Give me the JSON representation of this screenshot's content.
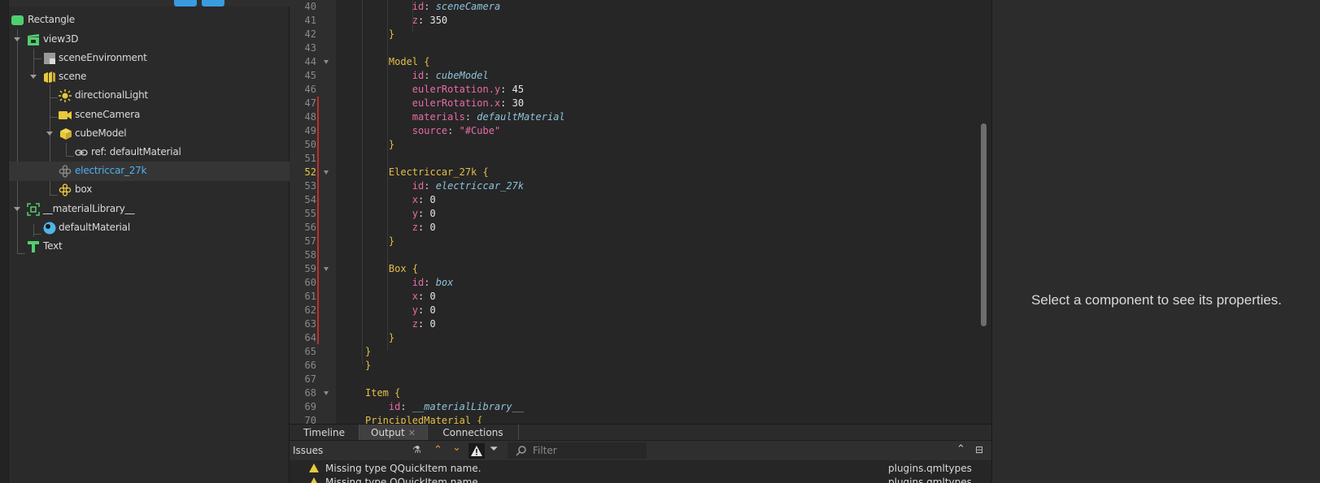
{
  "navigator": {
    "items": [
      {
        "label": "Rectangle",
        "icon": "rectangle-icon"
      },
      {
        "label": "view3D",
        "icon": "view3d-icon"
      },
      {
        "label": "sceneEnvironment",
        "icon": "scene-environment-icon"
      },
      {
        "label": "scene",
        "icon": "scene-node-icon"
      },
      {
        "label": "directionalLight",
        "icon": "light-icon"
      },
      {
        "label": "sceneCamera",
        "icon": "camera-icon"
      },
      {
        "label": "cubeModel",
        "icon": "model-icon"
      },
      {
        "label": "ref: defaultMaterial",
        "icon": "link-icon"
      },
      {
        "label": "electriccar_27k",
        "icon": "component-icon"
      },
      {
        "label": "box",
        "icon": "component-icon"
      },
      {
        "label": "__materialLibrary__",
        "icon": "item-icon"
      },
      {
        "label": "defaultMaterial",
        "icon": "material-icon"
      },
      {
        "label": "Text",
        "icon": "text-icon"
      }
    ],
    "selected": "electriccar_27k"
  },
  "editor": {
    "current_line": "52",
    "lines": [
      {
        "n": "40",
        "t": [
          [
            "        ",
            "p"
          ],
          [
            "id",
            "prop"
          ],
          [
            ": ",
            "p"
          ],
          [
            "sceneCamera",
            "id"
          ]
        ]
      },
      {
        "n": "41",
        "t": [
          [
            "        ",
            "p"
          ],
          [
            "z",
            "prop"
          ],
          [
            ": 350",
            "num"
          ]
        ]
      },
      {
        "n": "42",
        "t": [
          [
            "    }",
            "brace"
          ]
        ]
      },
      {
        "n": "43",
        "t": []
      },
      {
        "n": "44",
        "t": [
          [
            "    ",
            "p"
          ],
          [
            "Model",
            "type"
          ],
          [
            " {",
            "brace"
          ]
        ],
        "fold": true
      },
      {
        "n": "45",
        "t": [
          [
            "        ",
            "p"
          ],
          [
            "id",
            "prop"
          ],
          [
            ": ",
            "p"
          ],
          [
            "cubeModel",
            "id"
          ]
        ]
      },
      {
        "n": "46",
        "t": [
          [
            "        ",
            "p"
          ],
          [
            "eulerRotation.y",
            "prop"
          ],
          [
            ": 45",
            "num"
          ]
        ]
      },
      {
        "n": "47",
        "t": [
          [
            "        ",
            "p"
          ],
          [
            "eulerRotation.x",
            "prop"
          ],
          [
            ": 30",
            "num"
          ]
        ]
      },
      {
        "n": "48",
        "t": [
          [
            "        ",
            "p"
          ],
          [
            "materials",
            "prop"
          ],
          [
            ": ",
            "p"
          ],
          [
            "defaultMaterial",
            "id"
          ]
        ]
      },
      {
        "n": "49",
        "t": [
          [
            "        ",
            "p"
          ],
          [
            "source",
            "prop"
          ],
          [
            ": ",
            "p"
          ],
          [
            "\"#Cube\"",
            "str"
          ]
        ]
      },
      {
        "n": "50",
        "t": [
          [
            "    }",
            "brace"
          ]
        ]
      },
      {
        "n": "51",
        "t": []
      },
      {
        "n": "52",
        "t": [
          [
            "    ",
            "p"
          ],
          [
            "Electriccar_27k",
            "type"
          ],
          [
            " {",
            "brace"
          ]
        ],
        "fold": true
      },
      {
        "n": "53",
        "t": [
          [
            "        ",
            "p"
          ],
          [
            "id",
            "prop"
          ],
          [
            ": ",
            "p"
          ],
          [
            "electriccar_27k",
            "id"
          ]
        ]
      },
      {
        "n": "54",
        "t": [
          [
            "        ",
            "p"
          ],
          [
            "x",
            "prop"
          ],
          [
            ": 0",
            "num"
          ]
        ]
      },
      {
        "n": "55",
        "t": [
          [
            "        ",
            "p"
          ],
          [
            "y",
            "prop"
          ],
          [
            ": 0",
            "num"
          ]
        ]
      },
      {
        "n": "56",
        "t": [
          [
            "        ",
            "p"
          ],
          [
            "z",
            "prop"
          ],
          [
            ": 0",
            "num"
          ]
        ]
      },
      {
        "n": "57",
        "t": [
          [
            "    }",
            "brace"
          ]
        ]
      },
      {
        "n": "58",
        "t": []
      },
      {
        "n": "59",
        "t": [
          [
            "    ",
            "p"
          ],
          [
            "Box",
            "type"
          ],
          [
            " {",
            "brace"
          ]
        ],
        "fold": true
      },
      {
        "n": "60",
        "t": [
          [
            "        ",
            "p"
          ],
          [
            "id",
            "prop"
          ],
          [
            ": ",
            "p"
          ],
          [
            "box",
            "id"
          ]
        ]
      },
      {
        "n": "61",
        "t": [
          [
            "        ",
            "p"
          ],
          [
            "x",
            "prop"
          ],
          [
            ": 0",
            "num"
          ]
        ]
      },
      {
        "n": "62",
        "t": [
          [
            "        ",
            "p"
          ],
          [
            "y",
            "prop"
          ],
          [
            ": 0",
            "num"
          ]
        ]
      },
      {
        "n": "63",
        "t": [
          [
            "        ",
            "p"
          ],
          [
            "z",
            "prop"
          ],
          [
            ": 0",
            "num"
          ]
        ]
      },
      {
        "n": "64",
        "t": [
          [
            "    }",
            "brace"
          ]
        ]
      },
      {
        "n": "65",
        "t": [
          [
            "}",
            "brace"
          ]
        ]
      },
      {
        "n": "66",
        "t": [
          [
            "}",
            "brace"
          ]
        ]
      },
      {
        "n": "67",
        "t": []
      },
      {
        "n": "68",
        "t": [
          [
            "Item",
            "type"
          ],
          [
            " {",
            "brace"
          ]
        ],
        "fold": true
      },
      {
        "n": "69",
        "t": [
          [
            "    ",
            "p"
          ],
          [
            "id",
            "prop"
          ],
          [
            ": ",
            "p"
          ],
          [
            "__materialLibrary__",
            "id"
          ]
        ]
      },
      {
        "n": "70",
        "t": [
          [
            "PrincipledMaterial",
            "type"
          ],
          [
            " {",
            "brace"
          ]
        ]
      }
    ]
  },
  "bottom": {
    "tabs": [
      {
        "label": "Timeline"
      },
      {
        "label": "Output"
      },
      {
        "label": "Connections"
      }
    ],
    "issues_title": "Issues",
    "filter_placeholder": "Filter",
    "issues": [
      {
        "message": "Missing type QQuickItem name.",
        "source": "plugins.qmltypes"
      },
      {
        "message": "Missing type QQuickItem name.",
        "source": "plugins.qmltypes"
      }
    ]
  },
  "properties": {
    "empty_message": "Select a component to see its properties."
  },
  "colors": {
    "accent": "#3a9be0",
    "selected_text": "#4fb0ee",
    "warning": "#e8c93c",
    "change_bar": "#c42d2d"
  }
}
